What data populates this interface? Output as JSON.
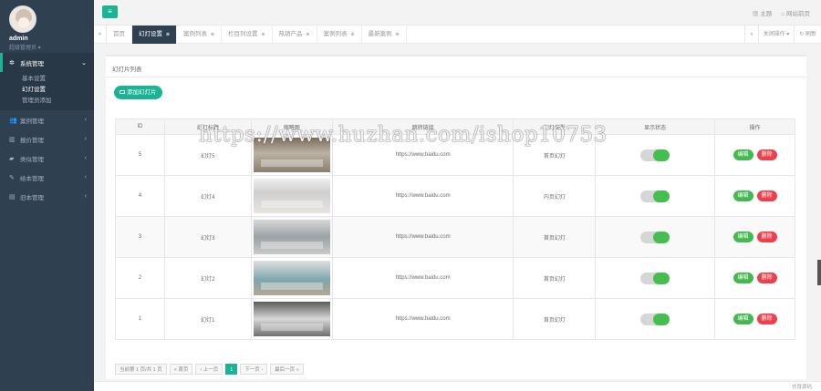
{
  "sidebar": {
    "user": {
      "name": "admin",
      "role": "超级管理员"
    },
    "menu": [
      {
        "label": "系统管理",
        "icon": "gear-icon",
        "active": true,
        "children": [
          "基本设置",
          "幻灯设置",
          "管理员添加"
        ]
      },
      {
        "label": "案例管理",
        "icon": "users-icon"
      },
      {
        "label": "报价管理",
        "icon": "chart-icon"
      },
      {
        "label": "类似管理",
        "icon": "truck-icon"
      },
      {
        "label": "给本管理",
        "icon": "edit-icon"
      },
      {
        "label": "旧本管理",
        "icon": "columns-icon"
      }
    ]
  },
  "topbar": {
    "menu_icon": "hamburger-icon",
    "theme": "主题",
    "home": "网站前页"
  },
  "tabs": {
    "items": [
      {
        "label": "首页"
      },
      {
        "label": "幻灯设置",
        "active": true
      },
      {
        "label": "案例列表"
      },
      {
        "label": "栏目列设置"
      },
      {
        "label": "热销产品"
      },
      {
        "label": "案例列表"
      },
      {
        "label": "最新案例"
      }
    ],
    "right": [
      "关闭操作",
      "刷新"
    ]
  },
  "panel": {
    "title": "幻灯片列表",
    "add_button": "添加幻灯片"
  },
  "table": {
    "headers": [
      "ID",
      "幻灯标题",
      "缩略图",
      "跳转链接",
      "幻灯类型",
      "显示状态",
      "操作"
    ],
    "rows": [
      {
        "id": "5",
        "title": "幻灯5",
        "link": "https://www.baidu.com",
        "type": "首页幻灯",
        "on": true
      },
      {
        "id": "4",
        "title": "幻灯4",
        "link": "https://www.baidu.com",
        "type": "内页幻灯",
        "on": true
      },
      {
        "id": "3",
        "title": "幻灯3",
        "link": "https://www.baidu.com",
        "type": "首页幻灯",
        "on": true
      },
      {
        "id": "2",
        "title": "幻灯2",
        "link": "https://www.baidu.com",
        "type": "首页幻灯",
        "on": true
      },
      {
        "id": "1",
        "title": "幻灯1",
        "link": "https://www.baidu.com",
        "type": "首页幻灯",
        "on": true
      }
    ],
    "edit_label": "编辑",
    "delete_label": "删除"
  },
  "pagination": {
    "summary": "当前第 1 页/共 1 页",
    "first": "« 首页",
    "prev": "‹ 上一页",
    "current": "1",
    "next": "下一页 ›",
    "last": "最后一页 »"
  },
  "watermark": "https://www.huzhan.com/ishop10753",
  "footer": {
    "text": "仿冒源码"
  }
}
